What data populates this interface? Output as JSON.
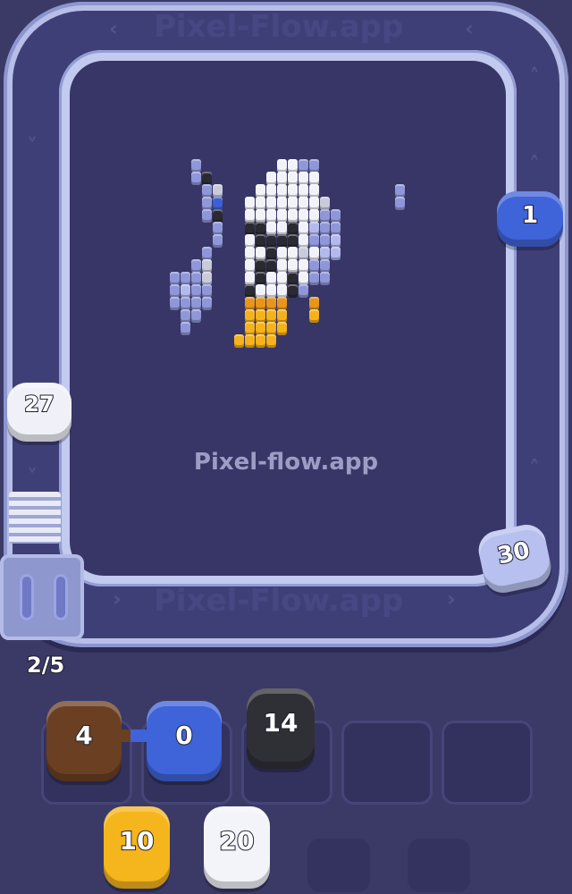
{
  "watermark": "Pixel-flow.app",
  "track_text": [
    "Pixel-Flow.app",
    "Pixel-Flow.app"
  ],
  "progress": "2/5",
  "colors": {
    "background": "#3b3a66",
    "track": "#b7bfe8",
    "board": "#373667"
  },
  "track_shooters": [
    {
      "id": "blue-shooter",
      "count": "1",
      "color": "#3f63d8"
    },
    {
      "id": "white-shooter",
      "count": "27",
      "color": "#f0f1f8"
    },
    {
      "id": "lavender-shooter",
      "count": "30",
      "color": "#b7c0ef"
    }
  ],
  "slot_shooters": [
    {
      "id": "brown-shooter",
      "count": "4",
      "color": "#6b3f22"
    },
    {
      "id": "blue-shooter",
      "count": "0",
      "color": "#3f63d8"
    },
    {
      "id": "black-shooter",
      "count": "14",
      "color": "#2f2f36"
    }
  ],
  "queue_shooters": [
    {
      "id": "yellow-shooter",
      "count": "10",
      "color": "#f5b51c"
    },
    {
      "id": "white-shooter",
      "count": "20",
      "color": "#f3f4fa"
    }
  ],
  "empty_slots": 2,
  "icons": [
    "chevron-icon",
    "stairs-icon",
    "gate-icon"
  ]
}
